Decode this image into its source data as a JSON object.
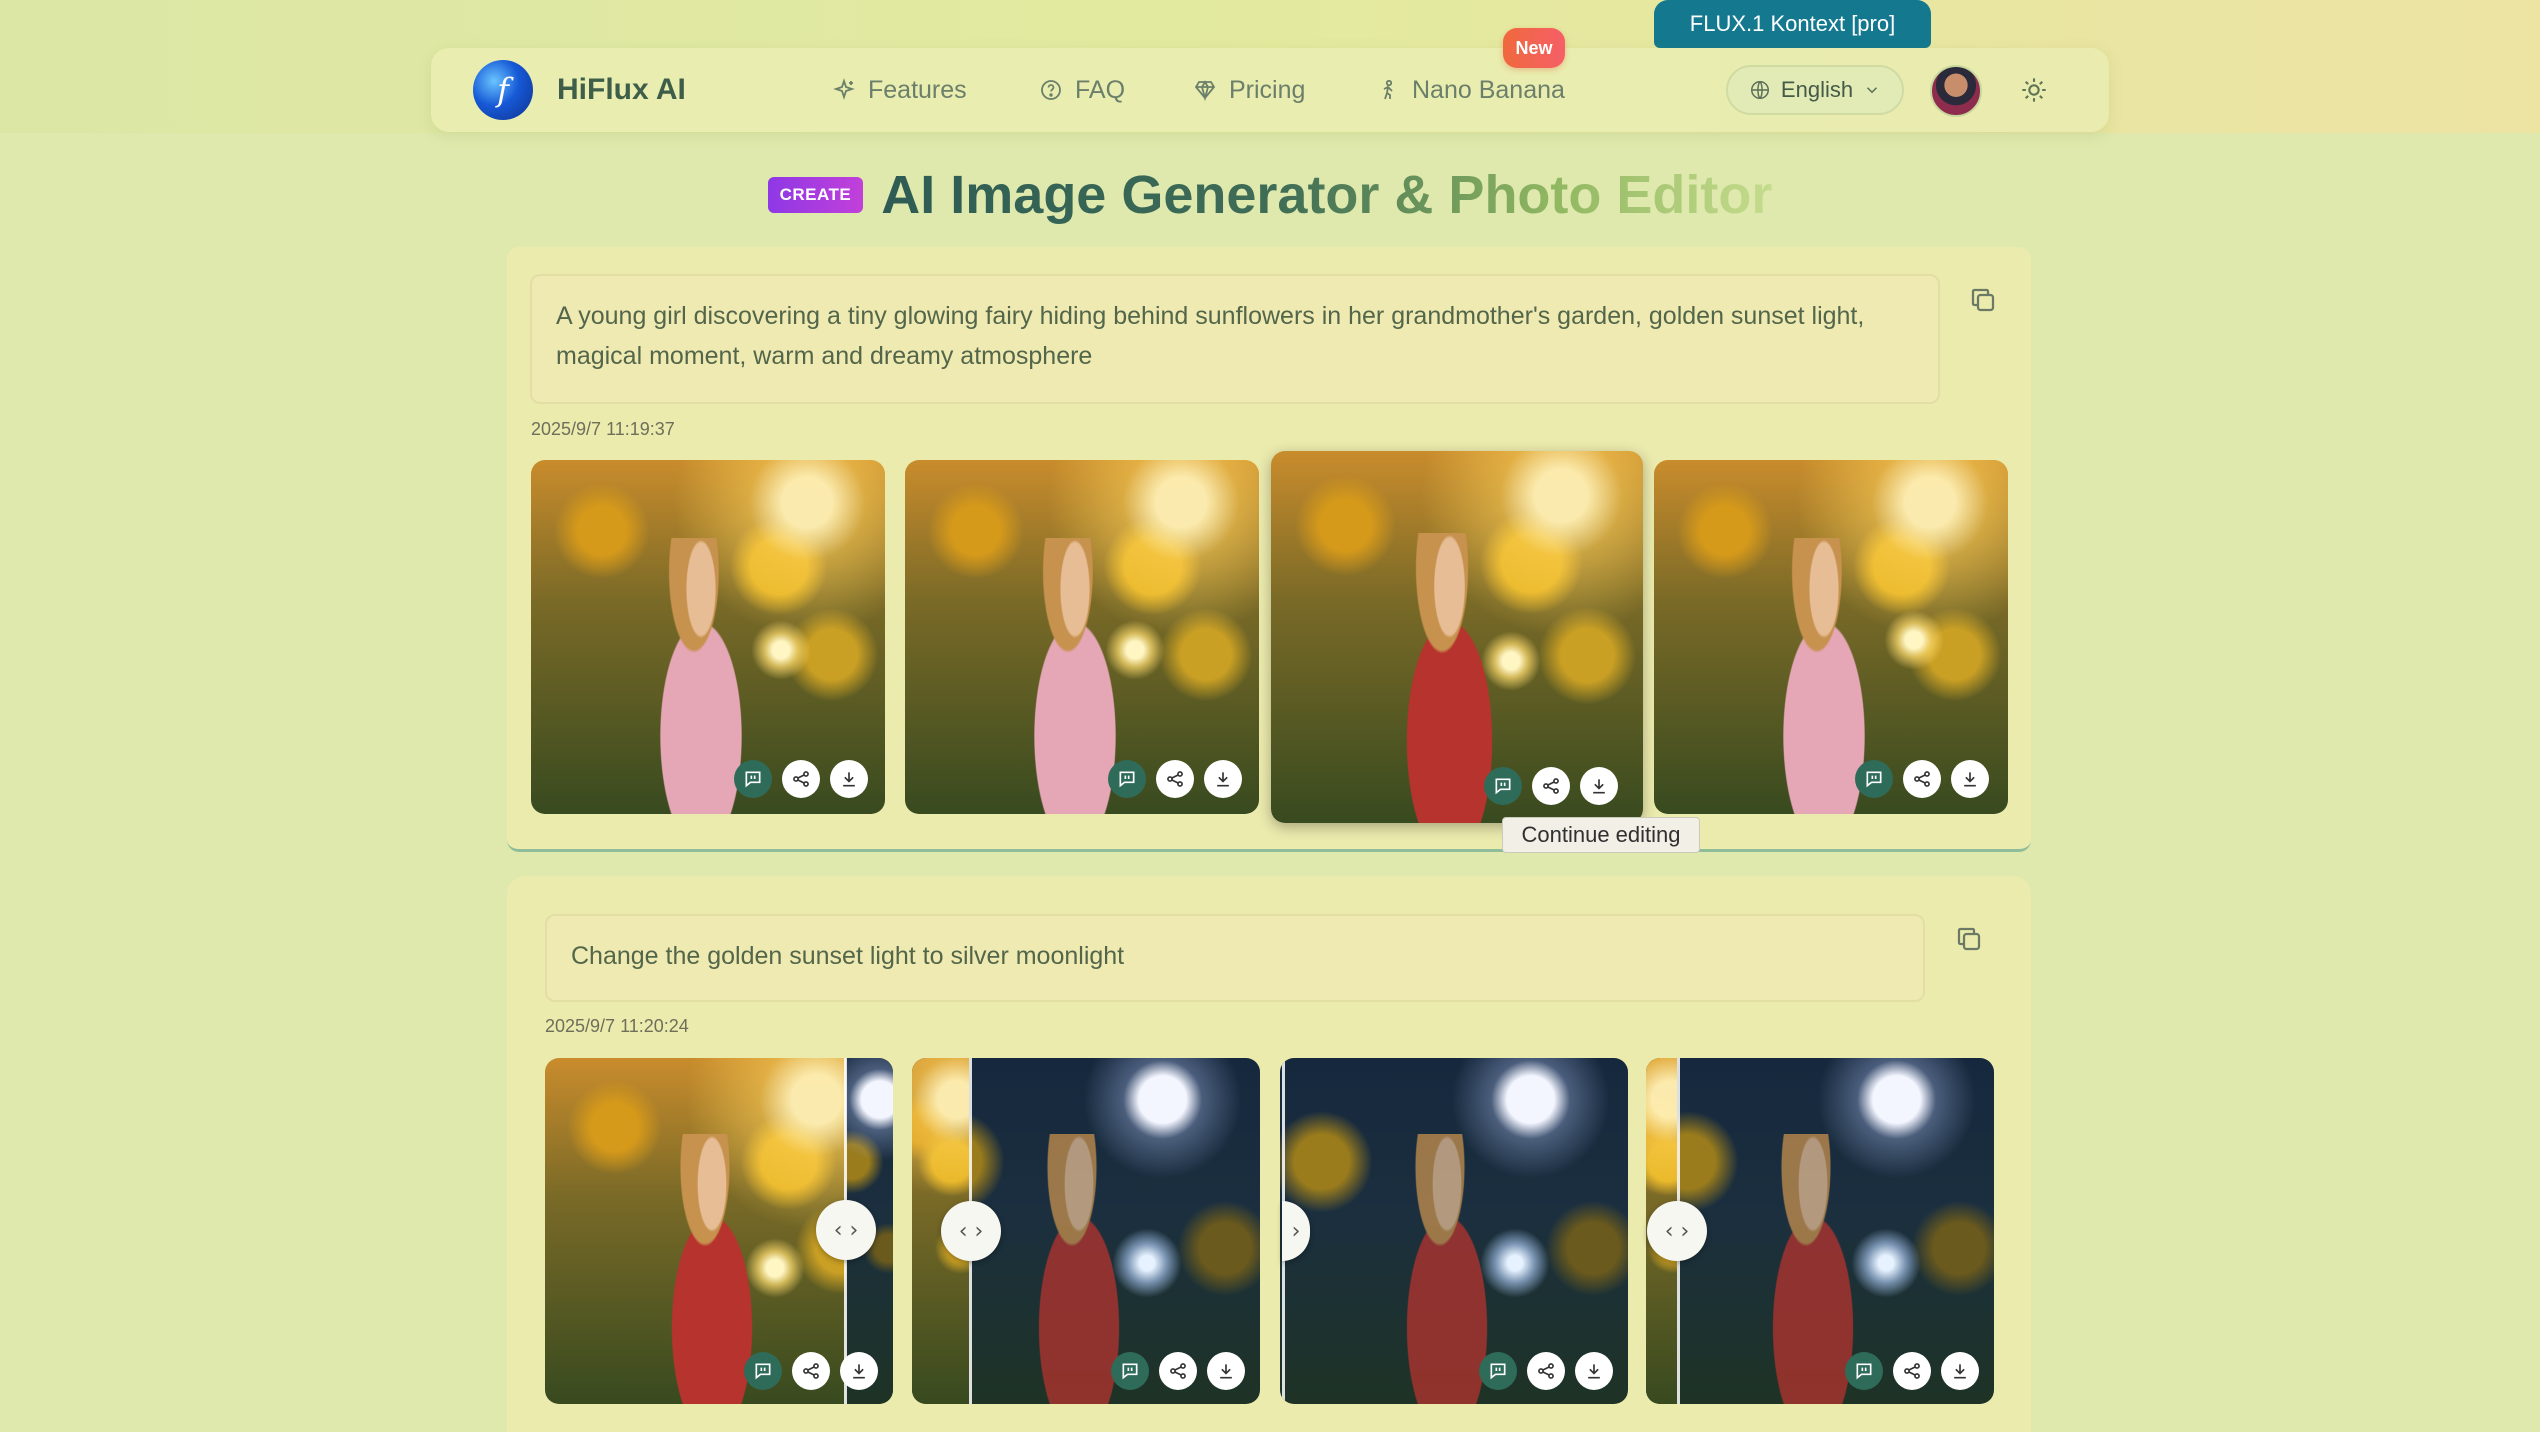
{
  "colors": {
    "accent": "#2f6b59",
    "page_background": "#dfe9ad",
    "new_badge": "#f0693d",
    "create_badge": "#8e38e6",
    "flux_tab": "#14798f"
  },
  "header": {
    "model_tab": "FLUX.1 Kontext [pro]",
    "brand": "HiFlux AI",
    "nav": [
      {
        "label": "Features",
        "icon": "sparkle-icon"
      },
      {
        "label": "FAQ",
        "icon": "question-circle-icon"
      },
      {
        "label": "Pricing",
        "icon": "diamond-icon"
      },
      {
        "label": "Nano Banana",
        "icon": "person-icon"
      }
    ],
    "new_badge": "New",
    "language": "English",
    "theme_icon": "sun-icon"
  },
  "headline": {
    "badge": "CREATE",
    "title": "AI Image Generator & Photo Editor"
  },
  "generations": [
    {
      "prompt": "A young girl discovering a tiny glowing fairy hiding behind sunflowers in her grandmother's garden, golden sunset light, magical moment, warm and dreamy atmosphere",
      "timestamp": "2025/9/7 11:19:37",
      "image_count": 4
    },
    {
      "prompt": "Change the golden sunset light to silver moonlight",
      "timestamp": "2025/9/7 11:20:24",
      "image_count": 4
    }
  ],
  "tooltip": "Continue editing",
  "split_handle_glyph": "‹ ›",
  "split_handle_glyph_partial": "›"
}
